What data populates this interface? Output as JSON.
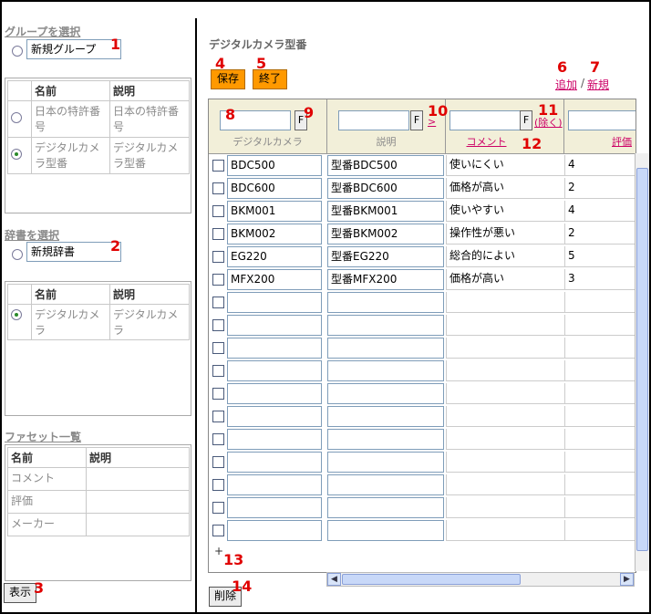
{
  "left": {
    "group_section_title": "グループを選択",
    "new_group_value": "新規グループ",
    "group_table": {
      "headers": [
        "名前",
        "説明"
      ],
      "rows": [
        {
          "name": "日本の特許番号",
          "desc": "日本の特許番号",
          "selected": false
        },
        {
          "name": "デジタルカメラ型番",
          "desc": "デジタルカメラ型番",
          "selected": true
        }
      ]
    },
    "dict_section_title": "辞書を選択",
    "new_dict_value": "新規辞書",
    "dict_table": {
      "headers": [
        "名前",
        "説明"
      ],
      "rows": [
        {
          "name": "デジタルカメラ",
          "desc": "デジタルカメラ",
          "selected": true
        }
      ]
    },
    "facet_section_title": "ファセット一覧",
    "facet_table": {
      "headers": [
        "名前",
        "説明"
      ],
      "rows": [
        {
          "name": "コメント",
          "desc": ""
        },
        {
          "name": "評価",
          "desc": ""
        },
        {
          "name": "メーカー",
          "desc": ""
        }
      ]
    },
    "show_button": "表示"
  },
  "main": {
    "title": "デジタルカメラ型番",
    "save_button": "保存",
    "exit_button": "終了",
    "add_link": "追加",
    "link_sep": "/",
    "new_link": "新規",
    "columns": [
      {
        "label": "デジタルカメラ",
        "filter_button": "F"
      },
      {
        "label": "説明",
        "filter_button": "F",
        "move_link": ">"
      },
      {
        "label": "コメント",
        "filter_button": "F",
        "remove_link": "(除く)"
      },
      {
        "label": "評価"
      }
    ],
    "rows": [
      {
        "model": "BDC500",
        "desc": "型番BDC500",
        "comment": "使いにくい",
        "rating": "4"
      },
      {
        "model": "BDC600",
        "desc": "型番BDC600",
        "comment": "価格が高い",
        "rating": "2"
      },
      {
        "model": "BKM001",
        "desc": "型番BKM001",
        "comment": "使いやすい",
        "rating": "4"
      },
      {
        "model": "BKM002",
        "desc": "型番BKM002",
        "comment": "操作性が悪い",
        "rating": "2"
      },
      {
        "model": "EG220",
        "desc": "型番EG220",
        "comment": "総合的によい",
        "rating": "5"
      },
      {
        "model": "MFX200",
        "desc": "型番MFX200",
        "comment": "価格が高い",
        "rating": "3"
      }
    ],
    "empty_row_count": 11,
    "add_row_symbol": "+",
    "delete_button": "削除"
  },
  "annotations": [
    "1",
    "2",
    "3",
    "4",
    "5",
    "6",
    "7",
    "8",
    "9",
    "10",
    "11",
    "12",
    "13",
    "14"
  ],
  "colors": {
    "accent_orange": "#ff9900",
    "link_red": "#cc0066",
    "annotation_red": "#e00000",
    "header_bg": "#f2efd9"
  }
}
